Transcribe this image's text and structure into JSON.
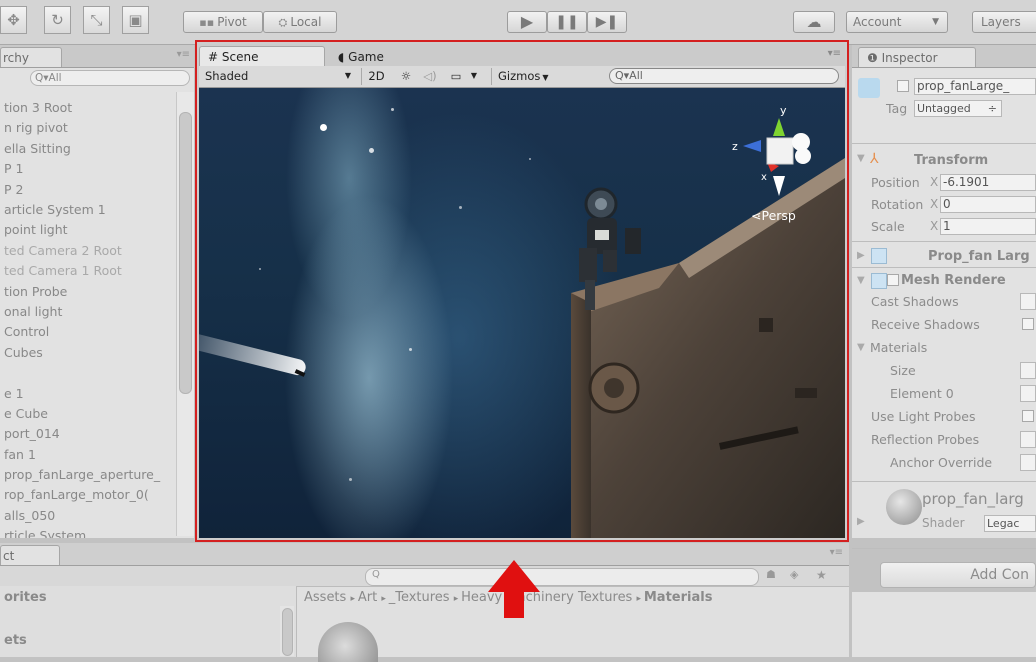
{
  "toolbar": {
    "pivot_label": "Pivot",
    "local_label": "Local",
    "account_label": "Account",
    "layers_label": "Layers"
  },
  "hierarchy": {
    "tab_label": "rchy",
    "search_placeholder": "Q▾All",
    "items": [
      "tion 3 Root",
      "n rig pivot",
      "ella Sitting",
      "P 1",
      "P 2",
      "article System 1",
      "point light",
      "ted Camera 2 Root",
      "ted Camera 1 Root",
      "tion Probe",
      "onal light",
      "Control",
      "Cubes",
      "",
      "e 1",
      "e Cube",
      "port_014",
      "fan 1",
      "prop_fanLarge_aperture_",
      "rop_fanLarge_motor_0(",
      "alls_050",
      "rticle System"
    ]
  },
  "scene": {
    "tab_scene": "Scene",
    "tab_game": "Game",
    "shading_mode": "Shaded",
    "btn_2d": "2D",
    "gizmos_label": "Gizmos",
    "search_placeholder": "Q▾All",
    "persp_label": "Persp",
    "gizmo_axis_y": "y",
    "gizmo_axis_z": "z",
    "gizmo_axis_x": "x"
  },
  "inspector": {
    "tab_label": "Inspector",
    "object_name": "prop_fanLarge_",
    "tag_label": "Tag",
    "tag_value": "Untagged",
    "transform_title": "Transform",
    "position_label": "Position",
    "position_x": "-6.1901",
    "rotation_label": "Rotation",
    "rotation_x": "0",
    "scale_label": "Scale",
    "scale_x": "1",
    "axis_x": "X",
    "prop_fan_title": "Prop_fan Larg",
    "mesh_renderer_title": "Mesh Rendere",
    "cast_shadows": "Cast Shadows",
    "receive_shadows": "Receive Shadows",
    "materials": "Materials",
    "size": "Size",
    "element0": "Element 0",
    "use_light_probes": "Use Light Probes",
    "reflection_probes": "Reflection Probes",
    "anchor_override": "Anchor Override",
    "material_name": "prop_fan_larg",
    "shader_label": "Shader",
    "shader_value": "Legac",
    "add_component": "Add Con"
  },
  "project": {
    "tab_label": "ct",
    "favorites": "orites",
    "assets": "ets",
    "breadcrumb": [
      "Assets",
      "Art",
      "_Textures",
      "Heavy Machinery Textures",
      "Materials"
    ]
  },
  "colors": {
    "highlight": "#d42020",
    "arrow": "#e01010"
  }
}
